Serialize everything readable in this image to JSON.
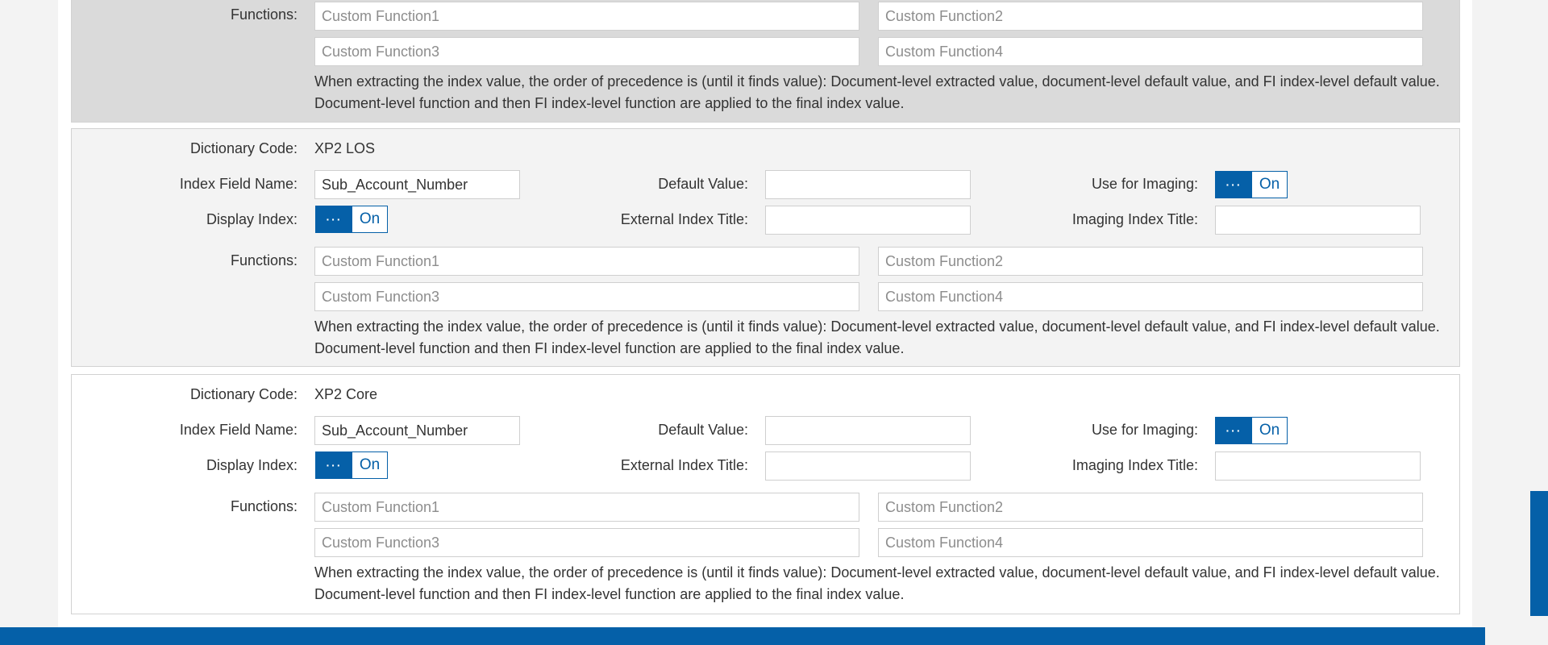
{
  "labels": {
    "functions": "Functions:",
    "dictionary_code": "Dictionary Code:",
    "index_field_name": "Index Field Name:",
    "default_value": "Default Value:",
    "use_for_imaging": "Use for Imaging:",
    "display_index": "Display Index:",
    "external_index_title": "External Index Title:",
    "imaging_index_title": "Imaging Index Title:"
  },
  "function_placeholders": [
    "Custom Function1",
    "Custom Function2",
    "Custom Function3",
    "Custom Function4"
  ],
  "precedence_note": "When extracting the index value, the order of precedence is (until it finds value): Document-level extracted value, document-level default value, and FI index-level default value. Document-level function and then FI index-level function are applied to the final index value.",
  "toggle": {
    "dots": "···",
    "on_label": "On"
  },
  "blocks": [
    {
      "dictionary_code": "XP2 LOS",
      "index_field_name": "Sub_Account_Number",
      "default_value": "",
      "external_index_title": "",
      "imaging_index_title": "",
      "use_for_imaging": true,
      "display_index": true
    },
    {
      "dictionary_code": "XP2 Core",
      "index_field_name": "Sub_Account_Number",
      "default_value": "",
      "external_index_title": "",
      "imaging_index_title": "",
      "use_for_imaging": true,
      "display_index": true
    }
  ],
  "colors": {
    "accent": "#0560a8",
    "panel_gray": "#dadada",
    "panel_light": "#f3f3f3"
  }
}
